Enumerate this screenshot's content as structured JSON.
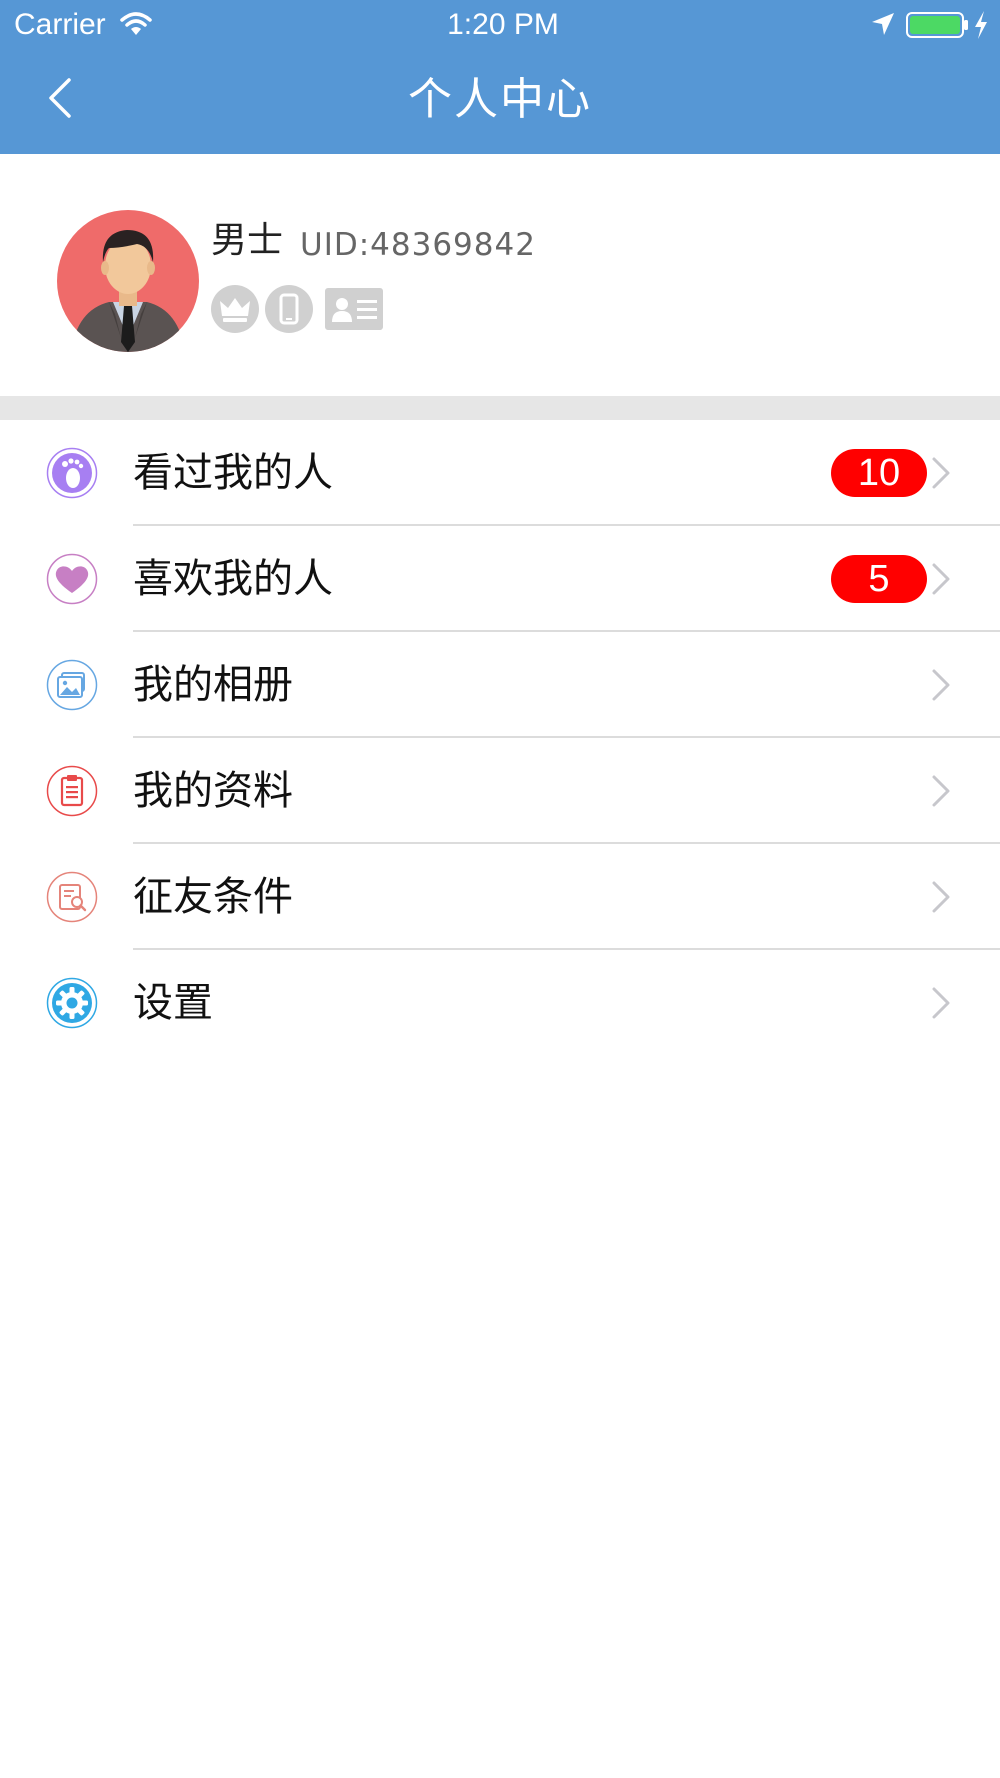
{
  "status_bar": {
    "carrier": "Carrier",
    "time": "1:20 PM",
    "battery_level": 1.0,
    "battery_color": "#4cd964"
  },
  "nav": {
    "title": "个人中心"
  },
  "profile": {
    "nickname": "男士",
    "uid": "UID:48369842",
    "avatar_bg": "#ef6b6a",
    "badges": [
      "crown-icon",
      "phone-icon",
      "id-card-icon"
    ]
  },
  "menu": {
    "items": [
      {
        "label": "看过我的人",
        "icon": "footprint-icon",
        "badge": "10",
        "icon_color": "#a77ff2"
      },
      {
        "label": "喜欢我的人",
        "icon": "heart-icon",
        "badge": "5",
        "icon_color": "#c77fc4"
      },
      {
        "label": "我的相册",
        "icon": "photo-album-icon",
        "icon_color": "#66a7e2"
      },
      {
        "label": "我的资料",
        "icon": "clipboard-icon",
        "icon_color": "#e84a4a"
      },
      {
        "label": "征友条件",
        "icon": "search-document-icon",
        "icon_color": "#e5847a"
      },
      {
        "label": "设置",
        "icon": "gear-icon",
        "icon_color": "#2fa8e4"
      }
    ]
  },
  "colors": {
    "header": "#5697d5",
    "badge": "#ff0000",
    "divider": "#e6e6e6"
  }
}
